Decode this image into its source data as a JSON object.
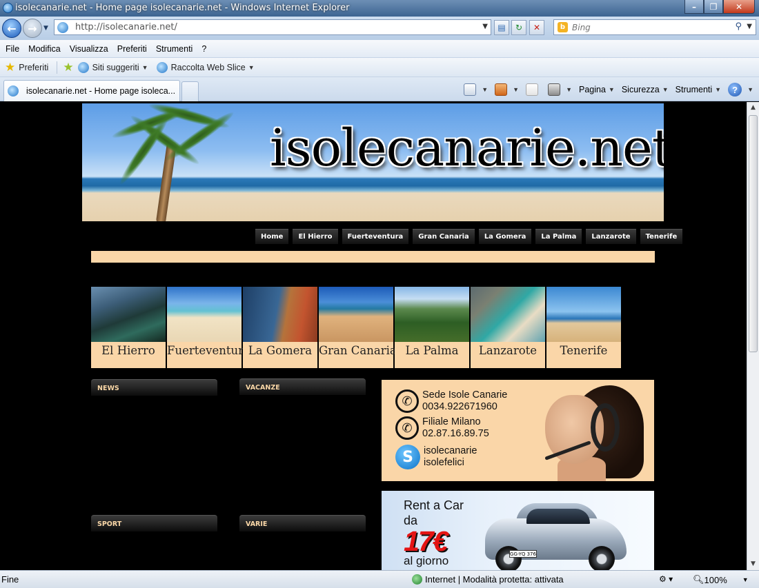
{
  "window": {
    "title": "isolecanarie.net - Home page isolecanarie.net - Windows Internet Explorer",
    "url": "http://isolecanarie.net/",
    "search_placeholder": "Bing"
  },
  "menu": [
    "File",
    "Modifica",
    "Visualizza",
    "Preferiti",
    "Strumenti",
    "?"
  ],
  "favorites_bar": {
    "favorites": "Preferiti",
    "suggested": "Siti suggeriti",
    "web_slice": "Raccolta Web Slice"
  },
  "tab": {
    "label": "isolecanarie.net - Home page isoleca..."
  },
  "command_bar": {
    "page": "Pagina",
    "security": "Sicurezza",
    "tools": "Strumenti"
  },
  "site": {
    "logo": "isolecanarie.net",
    "nav": [
      "Home",
      "El Hierro",
      "Fuerteventura",
      "Gran Canaria",
      "La Gomera",
      "La Palma",
      "Lanzarote",
      "Tenerife"
    ],
    "islands": [
      "El Hierro",
      "Fuerteventura",
      "La Gomera",
      "Gran Canaria",
      "La Palma",
      "Lanzarote",
      "Tenerife"
    ],
    "sections": {
      "news": "NEWS",
      "vacanze": "VACANZE",
      "sport": "SPORT",
      "varie": "VARIE"
    },
    "contact": {
      "office1_name": "Sede Isole Canarie",
      "office1_phone": "0034.922671960",
      "office2_name": "Filiale Milano",
      "office2_phone": "02.87.16.89.75",
      "skype1": "isolecanarie",
      "skype2": "isolefelici"
    },
    "car_ad": {
      "line1": "Rent a Car",
      "line2": "da",
      "price": "17€",
      "line3": "al giorno",
      "plate": "GG-YQ 376"
    }
  },
  "status": {
    "text": "Fine",
    "zone": "Internet | Modalità protetta: attivata",
    "zoom": "100%"
  }
}
